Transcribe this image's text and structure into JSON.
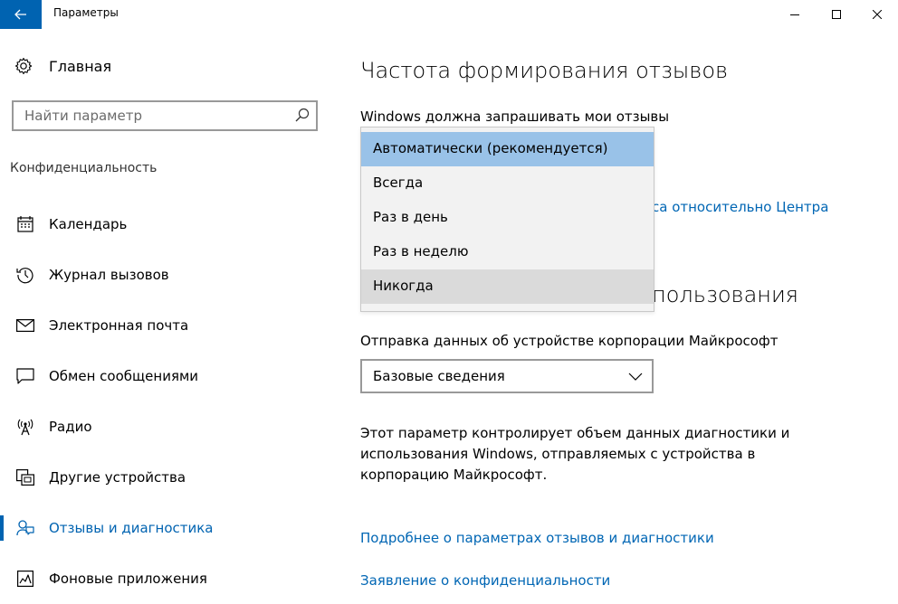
{
  "colors": {
    "accent": "#0063b1",
    "link": "#0066b4",
    "selected_option": "#99c2e8",
    "hover_option": "#dadada"
  },
  "window": {
    "title": "Параметры",
    "back_icon": "arrow-left-icon",
    "controls": [
      "minimize-icon",
      "maximize-icon",
      "close-icon"
    ]
  },
  "sidebar": {
    "home_label": "Главная",
    "home_icon": "gear-icon",
    "search": {
      "placeholder": "Найти параметр",
      "icon": "search-icon"
    },
    "section_title": "Конфиденциальность",
    "items": [
      {
        "label": "Календарь",
        "icon": "calendar-icon",
        "active": false
      },
      {
        "label": "Журнал вызовов",
        "icon": "history-icon",
        "active": false
      },
      {
        "label": "Электронная почта",
        "icon": "mail-icon",
        "active": false
      },
      {
        "label": "Обмен сообщениями",
        "icon": "message-icon",
        "active": false
      },
      {
        "label": "Радио",
        "icon": "radio-icon",
        "active": false
      },
      {
        "label": "Другие устройства",
        "icon": "devices-icon",
        "active": false
      },
      {
        "label": "Отзывы и диагностика",
        "icon": "feedback-icon",
        "active": true
      },
      {
        "label": "Фоновые приложения",
        "icon": "background-apps-icon",
        "active": false
      }
    ]
  },
  "main": {
    "title": "Частота формирования отзывов",
    "frequency_label": "Windows должна запрашивать мои отзывы",
    "frequency_dropdown": {
      "selected": "Автоматически (рекомендуется)",
      "hovered": "Никогда",
      "options": [
        "Автоматически (рекомендуется)",
        "Всегда",
        "Раз в день",
        "Раз в неделю",
        "Никогда"
      ]
    },
    "partial_link": "са относительно Центра",
    "partial_heading": "пользования",
    "send_label": "Отправка данных об устройстве корпорации Майкрософт",
    "send_value": "Базовые сведения",
    "description": "Этот параметр контролирует объем данных диагностики и использования Windows, отправляемых с устройства в корпорацию Майкрософт.",
    "link_feedback_settings": "Подробнее о параметрах отзывов и диагностики",
    "link_privacy": "Заявление о конфиденциальности"
  }
}
